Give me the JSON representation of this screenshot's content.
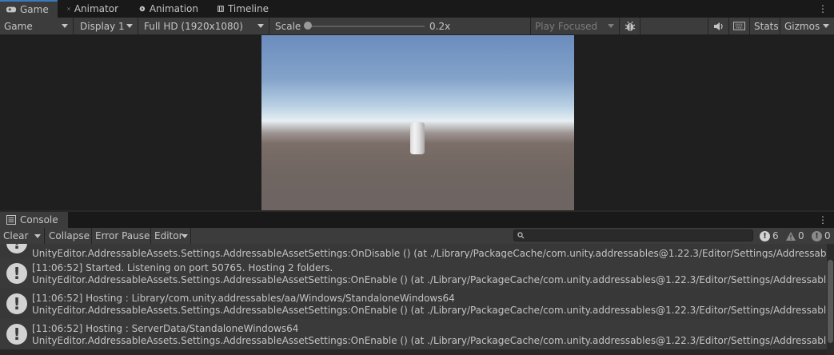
{
  "top_tabs": [
    {
      "label": "Game",
      "icon": "gamepad-icon",
      "active": true
    },
    {
      "label": "Animator",
      "icon": "animator-icon",
      "active": false
    },
    {
      "label": "Animation",
      "icon": "animation-icon",
      "active": false
    },
    {
      "label": "Timeline",
      "icon": "timeline-icon",
      "active": false
    }
  ],
  "game_toolbar": {
    "view_mode": "Game",
    "display": "Display 1",
    "resolution": "Full HD (1920x1080)",
    "scale_label": "Scale",
    "scale_value": "0.2x",
    "play_mode": "Play Focused",
    "stats": "Stats",
    "gizmos": "Gizmos"
  },
  "console": {
    "tab_label": "Console",
    "clear": "Clear",
    "collapse": "Collapse",
    "error_pause": "Error Pause",
    "editor": "Editor",
    "search_placeholder": "",
    "info_count": "6",
    "warning_count": "0",
    "error_count": "0",
    "entries": [
      {
        "line1": "",
        "line2": "UnityEditor.AddressableAssets.Settings.AddressableAssetSettings:OnDisable () (at ./Library/PackageCache/com.unity.addressables@1.22.3/Editor/Settings/AddressableAssetSetti"
      },
      {
        "line1": "[11:06:52] Started. Listening on port 50765. Hosting 2 folders.",
        "line2": "UnityEditor.AddressableAssets.Settings.AddressableAssetSettings:OnEnable () (at ./Library/PackageCache/com.unity.addressables@1.22.3/Editor/Settings/AddressableAssetSetti"
      },
      {
        "line1": "[11:06:52] Hosting : Library/com.unity.addressables/aa/Windows/StandaloneWindows64",
        "line2": "UnityEditor.AddressableAssets.Settings.AddressableAssetSettings:OnEnable () (at ./Library/PackageCache/com.unity.addressables@1.22.3/Editor/Settings/AddressableAssetSetti"
      },
      {
        "line1": "[11:06:52] Hosting : ServerData/StandaloneWindows64",
        "line2": "UnityEditor.AddressableAssets.Settings.AddressableAssetSettings:OnEnable () (at ./Library/PackageCache/com.unity.addressables@1.22.3/Editor/Settings/AddressableAssetSetti"
      }
    ]
  },
  "colors": {
    "accent": "#3a79bb",
    "panel": "#3c3c3c",
    "dark": "#191919"
  }
}
